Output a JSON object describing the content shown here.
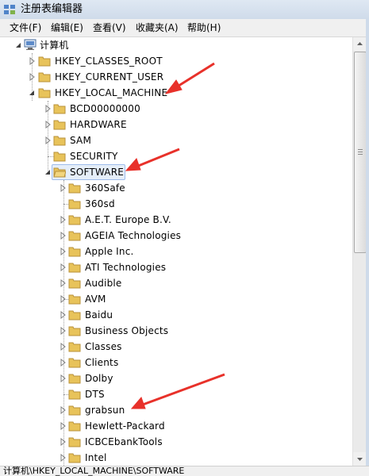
{
  "window": {
    "title": "注册表编辑器"
  },
  "menu": [
    "文件(F)",
    "编辑(E)",
    "查看(V)",
    "收藏夹(A)",
    "帮助(H)"
  ],
  "tree": {
    "root": "计算机",
    "hives": [
      "HKEY_CLASSES_ROOT",
      "HKEY_CURRENT_USER",
      "HKEY_LOCAL_MACHINE"
    ],
    "hklm_children": [
      "BCD00000000",
      "HARDWARE",
      "SAM",
      "SECURITY",
      "SOFTWARE"
    ],
    "software_children": [
      "360Safe",
      "360sd",
      "A.E.T. Europe B.V.",
      "AGEIA Technologies",
      "Apple Inc.",
      "ATI Technologies",
      "Audible",
      "AVM",
      "Baidu",
      "Business Objects",
      "Classes",
      "Clients",
      "Dolby",
      "DTS",
      "grabsun",
      "Hewlett-Packard",
      "ICBCEbankTools",
      "Intel"
    ]
  },
  "status": {
    "path": "计算机\\HKEY_LOCAL_MACHINE\\SOFTWARE"
  },
  "colors": {
    "annotation_arrow": "#e8312a",
    "selection": "#e5eef9",
    "folder": "#e8c35a"
  }
}
